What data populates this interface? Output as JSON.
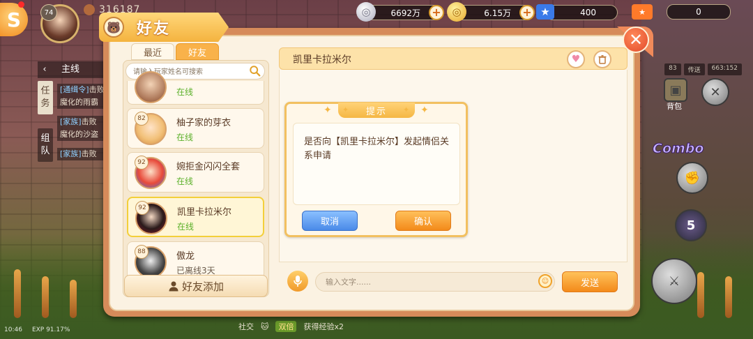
{
  "hud": {
    "player_level": "74",
    "power": "316187",
    "silver": "6692万",
    "gold": "6.15万",
    "tickets": "400",
    "bag_label": "背包",
    "inventory_count": "0"
  },
  "tasks": {
    "tab_main": "主线",
    "side_task": "任务",
    "side_team": "组队",
    "lines": [
      {
        "tag": "[通缉令]",
        "text": "击败"
      },
      {
        "tag": "",
        "text": "魔化的雨霸"
      },
      {
        "tag": "[家族]",
        "text": "击败"
      },
      {
        "tag": "",
        "text": "魔化的沙盗"
      },
      {
        "tag": "[家族]",
        "text": "击败"
      }
    ]
  },
  "right_hud": {
    "tabs": [
      "83",
      "传送",
      "663:152"
    ],
    "bag_label": "背包",
    "combo_label": "Combo",
    "skill_count": "5"
  },
  "dialog": {
    "title": "好友",
    "tabs": {
      "recent": "最近",
      "friends": "好友"
    },
    "search_placeholder": "请输入玩家姓名可搜索",
    "friends": [
      {
        "level": "",
        "name": "",
        "status": "在线"
      },
      {
        "level": "82",
        "name": "柚子家的芽衣",
        "status": "在线"
      },
      {
        "level": "92",
        "name": "婉拒金闪闪全套",
        "status": "在线"
      },
      {
        "level": "92",
        "name": "凯里卡拉米尔",
        "status": "在线"
      },
      {
        "level": "88",
        "name": "傲龙",
        "status": "已离线3天"
      }
    ],
    "add_friend_label": "好友添加",
    "chat": {
      "name": "凯里卡拉米尔",
      "input_placeholder": "输入文字......",
      "send_label": "发送"
    },
    "confirm": {
      "title": "提示",
      "message": "是否向【凯里卡拉米尔】发起情侣关系申请",
      "cancel_label": "取消",
      "ok_label": "确认"
    }
  },
  "status_bar": {
    "time": "10:46",
    "exp": "EXP 91.17%"
  },
  "bottom": {
    "social_label": "社交",
    "tip_tag": "双倍",
    "tip_text": "获得经验x2"
  },
  "colors": {
    "accent_orange": "#f38a1a",
    "online_green": "#5bb02a",
    "cancel_blue": "#4a8ae8",
    "dialog_frame": "#d68b5a"
  }
}
